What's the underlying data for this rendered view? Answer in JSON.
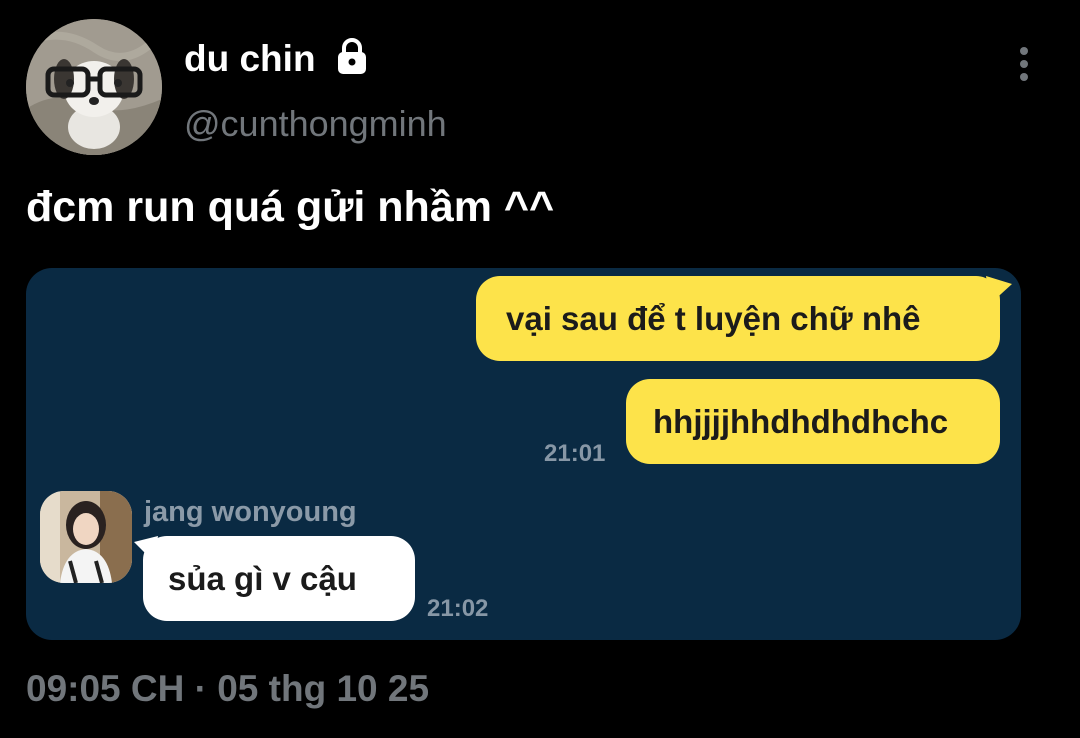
{
  "user": {
    "display_name": "du chin",
    "handle": "@cunthongminh",
    "verified_icon": "lock-icon",
    "avatar_icon": "plush-dog-with-glasses"
  },
  "actions": {
    "more_icon": "more-vertical-icon"
  },
  "tweet": {
    "text": "đcm run quá gửi nhầm ^^",
    "timestamp": "09:05 CH · 05 thg 10 25"
  },
  "chat": {
    "messages": [
      {
        "text": "vại sau để t luyện chữ nhê",
        "direction": "sent"
      },
      {
        "text": "hhjjjjhhdhdhdhchc",
        "direction": "sent",
        "time": "21:01"
      },
      {
        "text": "sủa gì v cậu",
        "direction": "received",
        "sender": "jang wonyoung",
        "time": "21:02"
      }
    ],
    "colors": {
      "background": "#0a2a43",
      "sent_bubble": "#fde34a",
      "received_bubble": "#ffffff"
    }
  }
}
